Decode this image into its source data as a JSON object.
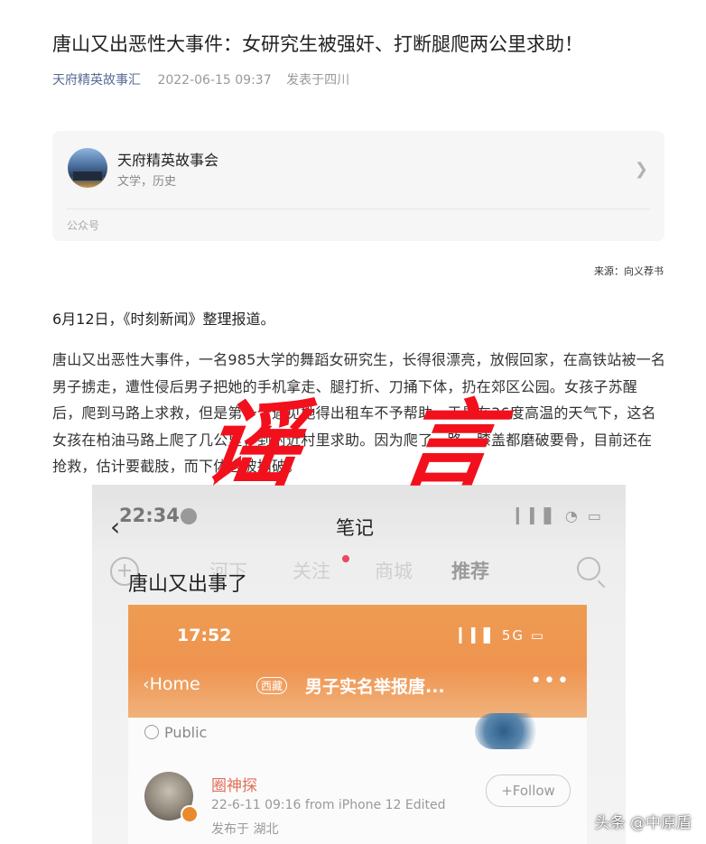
{
  "article": {
    "title": "唐山又出恶性大事件：女研究生被强奸、打断腿爬两公里求助！",
    "account": "天府精英故事汇",
    "date": "2022-06-15 09:37",
    "location": "发表于四川"
  },
  "account_card": {
    "name": "天府精英故事会",
    "tags": "文学，历史",
    "type": "公众号",
    "chevron_icon": "chevron-right-icon"
  },
  "source": "来源：向义荐书",
  "paragraphs": [
    "6月12日，《时刻新闻》整理报道。",
    "唐山又出恶性大事件，一名985大学的舞蹈女研究生，长得很漂亮，放假回家，在高铁站被一名男子掳走，遭性侵后男子把她的手机拿走、腿打折、刀捅下体，扔在郊区公园。女孩子苏醒后，爬到马路上求救，但是第一个遇见她得出租车不予帮助。于是在36度高温的天气下，这名女孩在柏油马路上爬了几公里，到附近村里求助。因为爬了一路，膝盖都磨破要骨，目前还在抢救，估计要截肢，而下体也被捅破。"
  ],
  "stamp": {
    "char1": "谣",
    "char2": "言",
    "color": "#f2101c"
  },
  "screenshot": {
    "time": "22:34",
    "heading": "笔记",
    "tabs": [
      "河下",
      "关注",
      "商城",
      "推荐"
    ],
    "note_title": "唐山又出事了",
    "inner": {
      "time": "17:52",
      "status": "5G",
      "back": "Home",
      "badge": "西藏",
      "title": "男子实名举报唐...",
      "visibility": "Public",
      "user": "圈神探",
      "post_info": "22-6-11 09:16  from iPhone 12  Edited",
      "location": "发布于 湖北",
      "follow": "+Follow"
    }
  },
  "watermark": "头条 @中原盾"
}
